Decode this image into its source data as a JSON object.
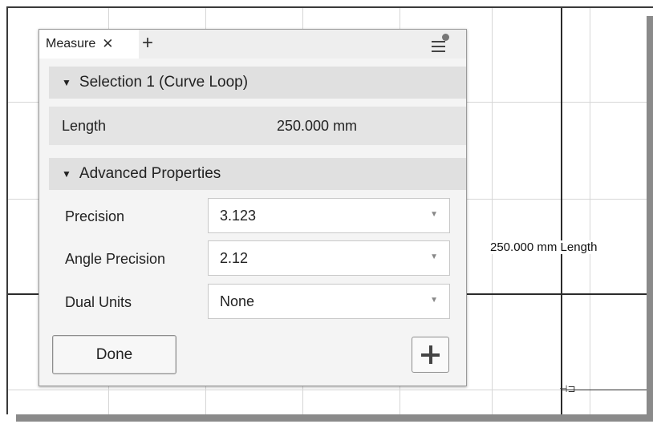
{
  "panel": {
    "tab_label": "Measure",
    "tab_close": "✕",
    "tab_add": "+",
    "menu_icon": "menu-icon"
  },
  "selection": {
    "heading": "Selection 1 (Curve Loop)",
    "length_label": "Length",
    "length_value": "250.000 mm"
  },
  "advanced": {
    "heading": "Advanced Properties",
    "rows": [
      {
        "label": "Precision",
        "value": "3.123"
      },
      {
        "label": "Angle Precision",
        "value": "2.12"
      },
      {
        "label": "Dual Units",
        "value": "None"
      }
    ]
  },
  "buttons": {
    "done": "Done"
  },
  "canvas": {
    "dimension_label": "250.000 mm Length"
  },
  "colors": {
    "panel_bg": "#f4f4f4",
    "section_bg": "#e0e0e0",
    "sketch_line": "#2b2b2b"
  }
}
